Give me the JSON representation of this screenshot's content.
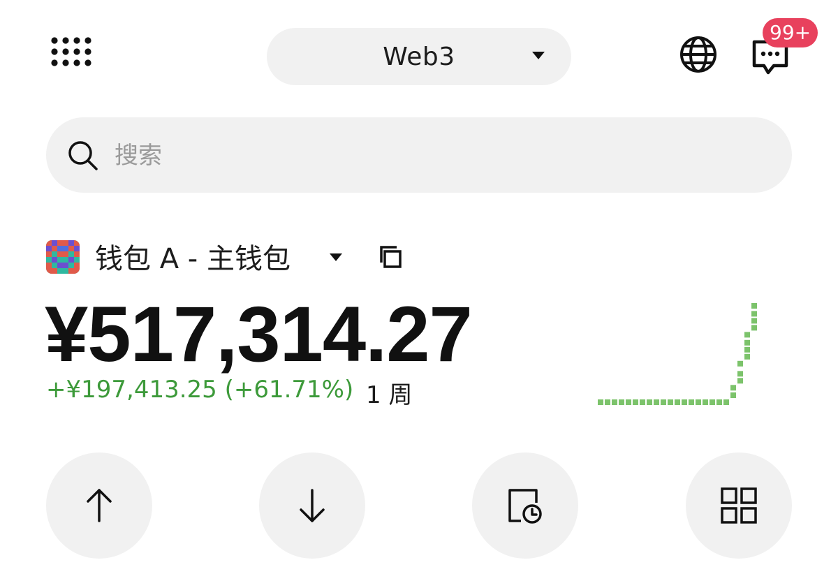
{
  "header": {
    "mode_label": "Web3",
    "notification_badge": "99+"
  },
  "search": {
    "placeholder": "搜索"
  },
  "wallet": {
    "name": "钱包 A - 主钱包",
    "balance": "¥517,314.27",
    "change": "+¥197,413.25 (+61.71%)",
    "period": "1 周"
  },
  "sparkline": {
    "color": "#7cc36b",
    "relative_values": [
      0,
      0,
      0,
      0,
      0,
      0,
      0,
      0,
      0,
      0,
      0,
      0,
      0,
      0,
      0,
      0,
      0,
      0,
      0,
      0.15,
      0.4,
      0.7,
      1.0
    ]
  },
  "actions": {
    "icons": [
      "arrow-up-icon",
      "arrow-down-icon",
      "history-icon",
      "grid-icon"
    ]
  },
  "colors": {
    "positive": "#3d9a3a",
    "badge": "#e8415d",
    "pill_bg": "#f1f1f1"
  }
}
